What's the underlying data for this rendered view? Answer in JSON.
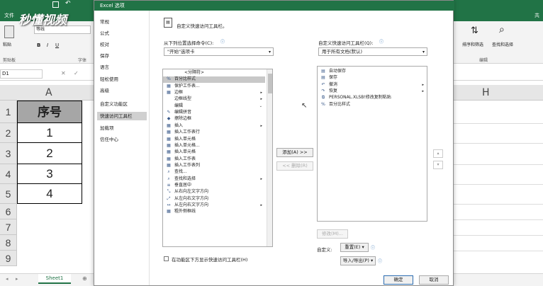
{
  "excel": {
    "file_tab": "文件",
    "ribbon": {
      "paste_label": "粘贴",
      "clipboard_label": "剪贴板",
      "font_name": "等线",
      "font_group_label": "字体",
      "sort_filter_label": "排序和筛选",
      "find_select_label": "查找和选择",
      "edit_group_label": "编辑",
      "share_label": "共"
    },
    "name_box": "D1",
    "columns": [
      "A",
      "H"
    ],
    "rows": [
      "1",
      "2",
      "3",
      "4",
      "5",
      "6",
      "7",
      "8",
      "9"
    ],
    "cells": [
      "序号",
      "1",
      "2",
      "3",
      "4"
    ],
    "sheet_tab": "Sheet1",
    "watermark": "秒懂视频"
  },
  "dialog": {
    "title": "Excel 选项",
    "nav": [
      "常规",
      "公式",
      "校对",
      "保存",
      "语言",
      "轻松使用",
      "高级",
      "自定义功能区",
      "快速访问工具栏",
      "加载项",
      "信任中心"
    ],
    "nav_selected": 8,
    "header": "自定义快速访问工具栏。",
    "choose_from_label": "从下列位置选择命令(C):",
    "choose_from_value": "\"开始\"选项卡",
    "customize_for_label": "自定义快速访问工具栏(Q):",
    "customize_for_value": "用于所有文档(默认)",
    "left_list": [
      {
        "icon": "",
        "text": "<分隔符>",
        "arrow": ""
      },
      {
        "icon": "%",
        "text": "百分比样式",
        "arrow": ""
      },
      {
        "icon": "▦",
        "text": "保护工作表...",
        "arrow": ""
      },
      {
        "icon": "▦",
        "text": "边框",
        "arrow": "▸"
      },
      {
        "icon": "",
        "text": "边框线型",
        "arrow": "▸"
      },
      {
        "icon": "",
        "text": "编辑",
        "arrow": "⌄"
      },
      {
        "icon": "✎",
        "text": "编辑拼音",
        "arrow": ""
      },
      {
        "icon": "◆",
        "text": "擦除边框",
        "arrow": ""
      },
      {
        "icon": "▦",
        "text": "插入",
        "arrow": "▸"
      },
      {
        "icon": "▦",
        "text": "插入工作表行",
        "arrow": ""
      },
      {
        "icon": "▦",
        "text": "插入单元格",
        "arrow": ""
      },
      {
        "icon": "▦",
        "text": "插入单元格...",
        "arrow": ""
      },
      {
        "icon": "▦",
        "text": "插入单元格",
        "arrow": ""
      },
      {
        "icon": "▦",
        "text": "插入工作表",
        "arrow": ""
      },
      {
        "icon": "▦",
        "text": "插入工作表列",
        "arrow": ""
      },
      {
        "icon": "⌕",
        "text": "查找...",
        "arrow": ""
      },
      {
        "icon": "⌕",
        "text": "查找和选择",
        "arrow": "▸"
      },
      {
        "icon": "≡",
        "text": "垂直居中",
        "arrow": ""
      },
      {
        "icon": "⤡",
        "text": "从右向左文字方向",
        "arrow": ""
      },
      {
        "icon": "⤢",
        "text": "从左向右文字方向",
        "arrow": ""
      },
      {
        "icon": "↔",
        "text": "从左向右文字方向",
        "arrow": "▸"
      },
      {
        "icon": "▦",
        "text": "粗外侧框线",
        "arrow": ""
      }
    ],
    "left_selected": 1,
    "add_button": "添加(A) >>",
    "remove_button": "<< 删除(R)",
    "right_list": [
      {
        "icon": "▤",
        "text": "自动保存",
        "arrow": ""
      },
      {
        "icon": "▤",
        "text": "保存",
        "arrow": ""
      },
      {
        "icon": "↶",
        "text": "撤消",
        "arrow": "▸"
      },
      {
        "icon": "↷",
        "text": "恢复",
        "arrow": "▸"
      },
      {
        "icon": "⧉",
        "text": "PERSONAL.XLSB!修改复制粘贴",
        "arrow": ""
      },
      {
        "icon": "%",
        "text": "百分比样式",
        "arrow": ""
      }
    ],
    "modify_button": "修改(M)...",
    "customize_label": "自定义:",
    "reset_button": "重置(E)",
    "import_export_button": "导入/导出(P)",
    "show_below_checkbox": "在功能区下方显示快速访问工具栏(H)",
    "ok_button": "确定",
    "cancel_button": "取消"
  },
  "colors": {
    "excel_green": "#217346",
    "header_fill": "#a6a6a6"
  }
}
